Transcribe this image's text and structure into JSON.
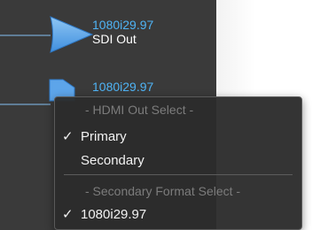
{
  "ports": {
    "sdi": {
      "format": "1080i29.97",
      "name": "SDI Out",
      "icon": "sdi-out-arrow-icon"
    },
    "hdmi": {
      "format": "1080i29.97",
      "icon": "hdmi-out-icon"
    }
  },
  "menu": {
    "hdmi_header": "- HDMI Out Select -",
    "items": [
      {
        "label": "Primary",
        "checked": true,
        "check": "✓"
      },
      {
        "label": "Secondary",
        "checked": false,
        "check": ""
      }
    ],
    "format_header": "- Secondary Format Select -",
    "format_items": [
      {
        "label": "1080i29.97",
        "checked": true,
        "check": "✓"
      }
    ]
  },
  "colors": {
    "panel": "#3a3a3a",
    "format_text": "#4fb3f4",
    "arrow": "#5da5ea",
    "menu_bg": "#2c2c2c",
    "header_text": "#7c7c7c"
  }
}
